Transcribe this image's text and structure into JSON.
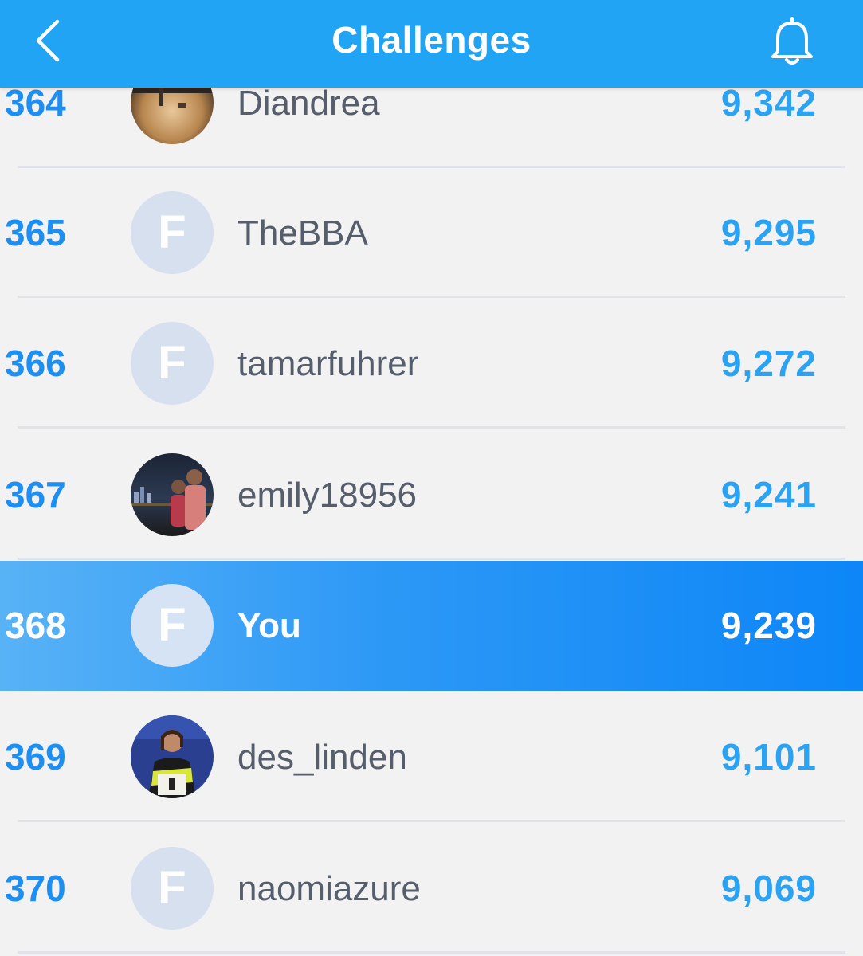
{
  "header": {
    "title": "Challenges",
    "back_icon": "chevron-left-icon",
    "bell_icon": "bell-icon",
    "background": "#20a4f3"
  },
  "leaderboard": {
    "rows": [
      {
        "rank": "364",
        "name": "Diandrea",
        "score": "9,342",
        "avatar": "photo"
      },
      {
        "rank": "365",
        "name": "TheBBA",
        "score": "9,295",
        "avatar": "F"
      },
      {
        "rank": "366",
        "name": "tamarfuhrer",
        "score": "9,272",
        "avatar": "F"
      },
      {
        "rank": "367",
        "name": "emily18956",
        "score": "9,241",
        "avatar": "photo"
      },
      {
        "rank": "368",
        "name": "You",
        "score": "9,239",
        "avatar": "F",
        "highlight": true
      },
      {
        "rank": "369",
        "name": "des_linden",
        "score": "9,101",
        "avatar": "photo"
      },
      {
        "rank": "370",
        "name": "naomiazure",
        "score": "9,069",
        "avatar": "F"
      }
    ]
  },
  "colors": {
    "accent": "#1e8ff2",
    "score": "#2ba3f2",
    "highlight_start": "#58b2f6",
    "highlight_end": "#0d86f7",
    "name_text": "#565d6b",
    "avatar_placeholder": "#d6e0ee"
  }
}
